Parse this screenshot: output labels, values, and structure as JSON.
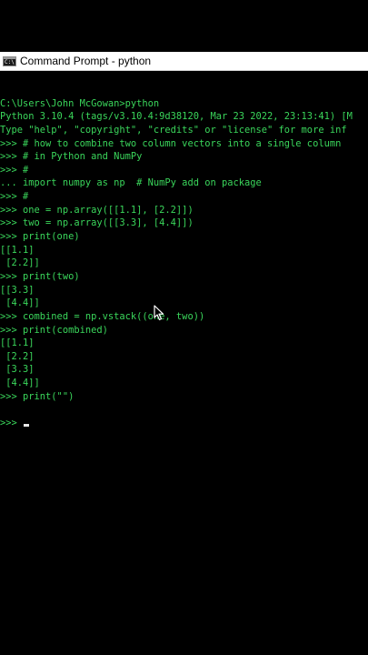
{
  "window": {
    "icon": "command-prompt-icon",
    "icon_glyph": "C:\\",
    "title": "Command Prompt - python"
  },
  "colors": {
    "background": "#000000",
    "console_text": "#3ad65b",
    "titlebar": "#ffffff"
  },
  "console": {
    "lines": [
      "",
      "C:\\Users\\John McGowan>python",
      "Python 3.10.4 (tags/v3.10.4:9d38120, Mar 23 2022, 23:13:41) [M",
      "Type \"help\", \"copyright\", \"credits\" or \"license\" for more inf",
      ">>> # how to combine two column vectors into a single column",
      ">>> # in Python and NumPy",
      ">>> #",
      "... import numpy as np  # NumPy add on package",
      ">>> #",
      ">>> one = np.array([[1.1], [2.2]])",
      ">>> two = np.array([[3.3], [4.4]])",
      ">>> print(one)",
      "[[1.1]",
      " [2.2]]",
      ">>> print(two)",
      "[[3.3]",
      " [4.4]]",
      ">>> combined = np.vstack((one, two))",
      ">>> print(combined)",
      "[[1.1]",
      " [2.2]",
      " [3.3]",
      " [4.4]]",
      ">>> print(\"\")",
      "",
      ">>> "
    ]
  }
}
